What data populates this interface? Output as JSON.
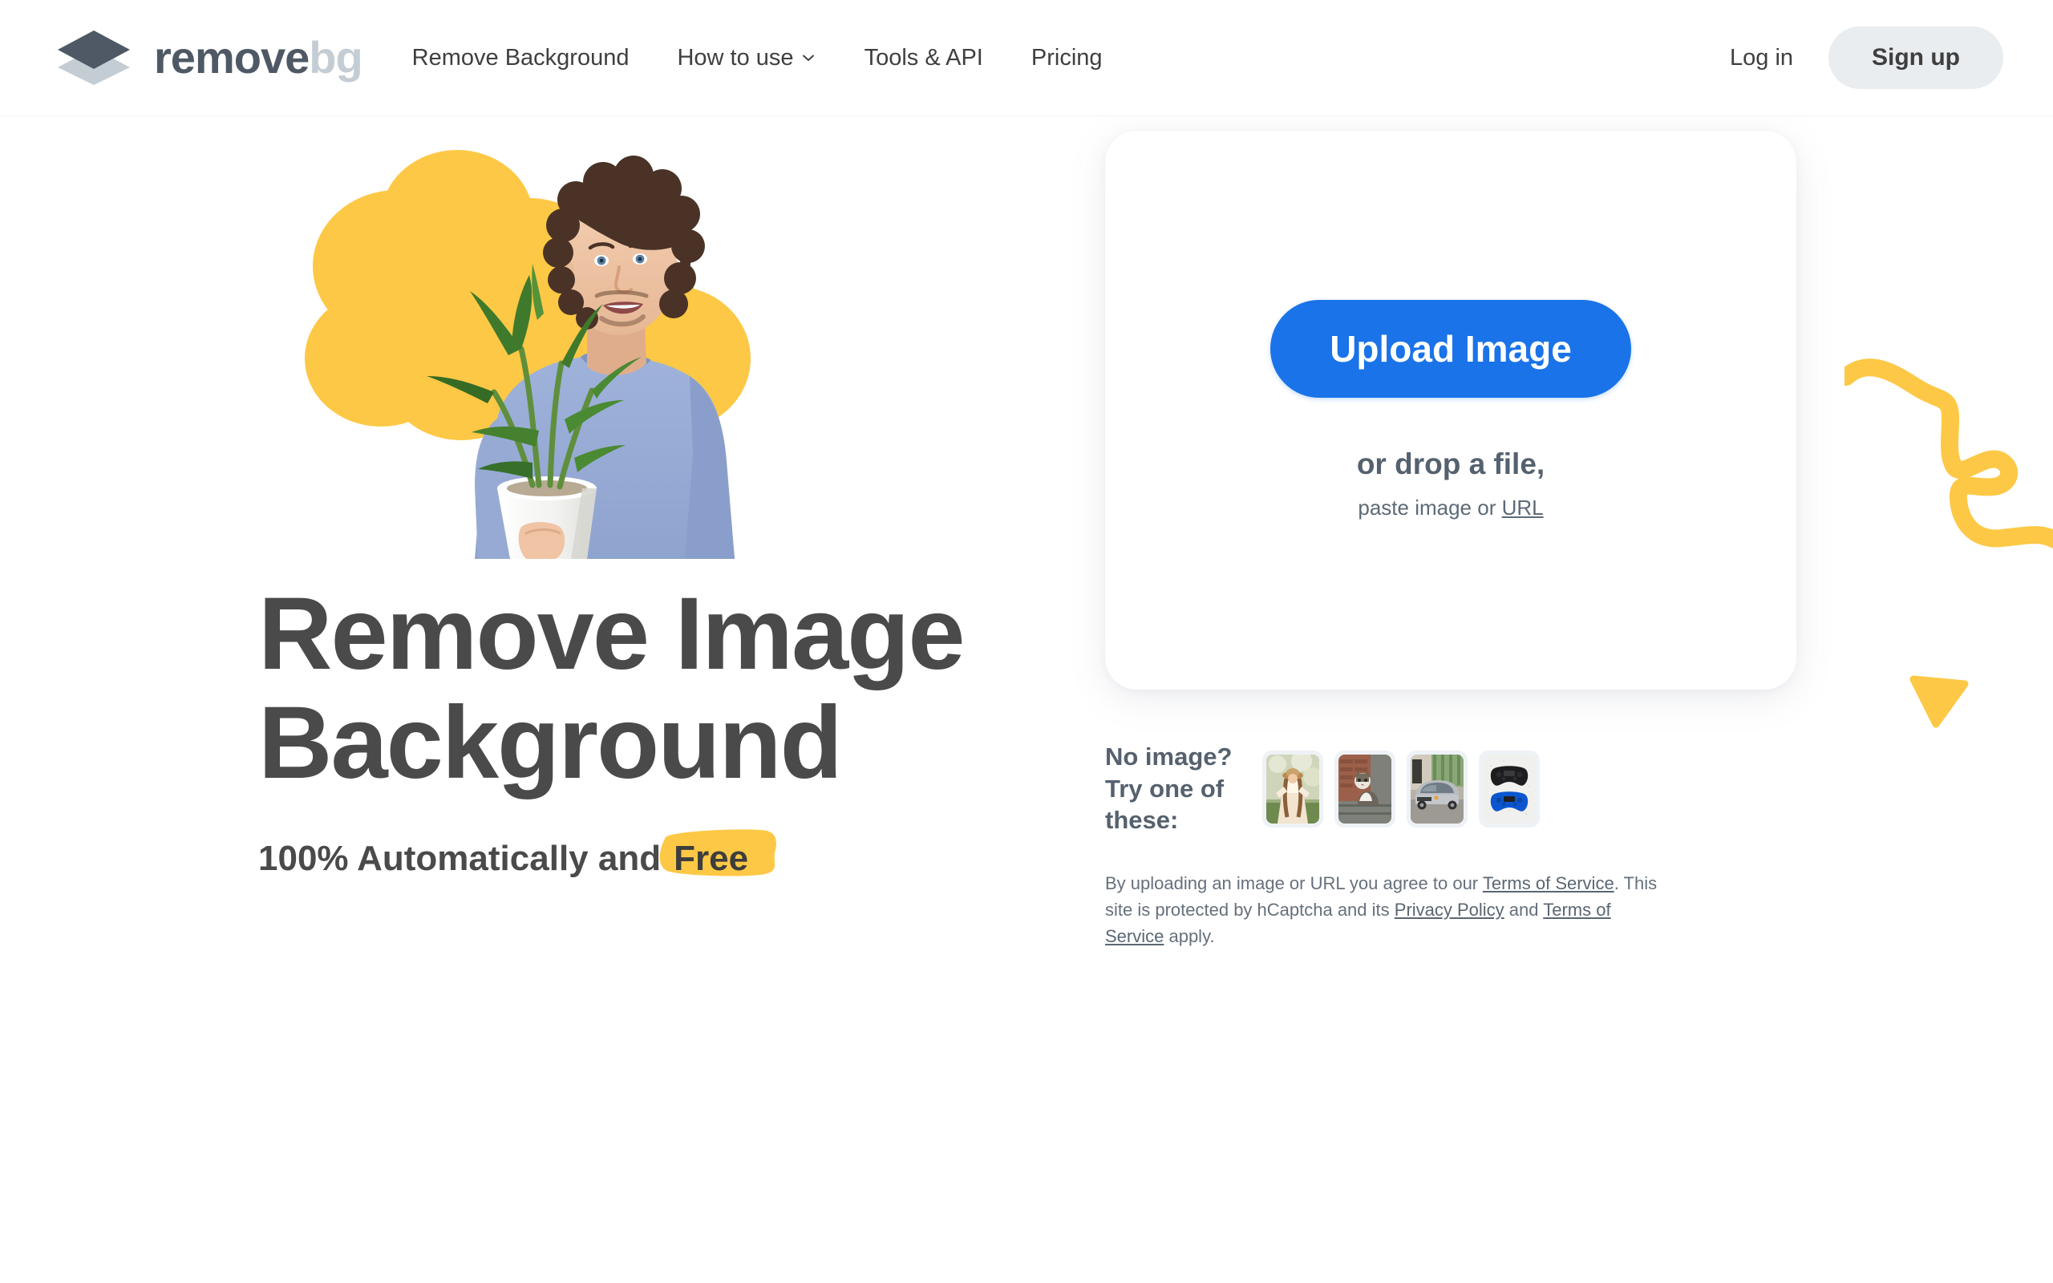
{
  "brand": {
    "name_primary": "remove",
    "name_secondary": "bg",
    "logo_icon": "layers-diamond-icon",
    "logo_color_top": "#4e5965",
    "logo_color_bottom": "#c5cdd4"
  },
  "nav": {
    "links": [
      {
        "label": "Remove Background",
        "has_dropdown": false
      },
      {
        "label": "How to use",
        "has_dropdown": true,
        "dropdown_icon": "chevron-down-icon"
      },
      {
        "label": "Tools & API",
        "has_dropdown": false
      },
      {
        "label": "Pricing",
        "has_dropdown": false
      }
    ],
    "login_label": "Log in",
    "signup_label": "Sign up"
  },
  "hero": {
    "title_line1": "Remove Image",
    "title_line2": "Background",
    "subtitle_prefix": "100% Automatically and",
    "subtitle_highlight": "Free",
    "highlight_color": "#fdc845",
    "artwork": "man-holding-potted-plant-with-yellow-blob"
  },
  "upload": {
    "button_label": "Upload Image",
    "button_color": "#1a73e8",
    "drop_text": "or drop a file,",
    "paste_prefix": "paste image or",
    "paste_link_label": "URL"
  },
  "samples": {
    "label_line1": "No image?",
    "label_line2": "Try one of these:",
    "thumbnails": [
      {
        "name": "woman-in-hat-portrait"
      },
      {
        "name": "cat-on-ledge"
      },
      {
        "name": "silver-suv-car"
      },
      {
        "name": "game-controllers"
      }
    ]
  },
  "legal": {
    "part1": "By uploading an image or URL you agree to our ",
    "link1": "Terms of Service",
    "part2": ". This site is protected by hCaptcha and its ",
    "link2": "Privacy Policy",
    "part3": " and ",
    "link3": "Terms of Service",
    "part4": " apply."
  },
  "decor": {
    "squiggle_color": "#fdc845",
    "triangle_color": "#fdc845"
  }
}
